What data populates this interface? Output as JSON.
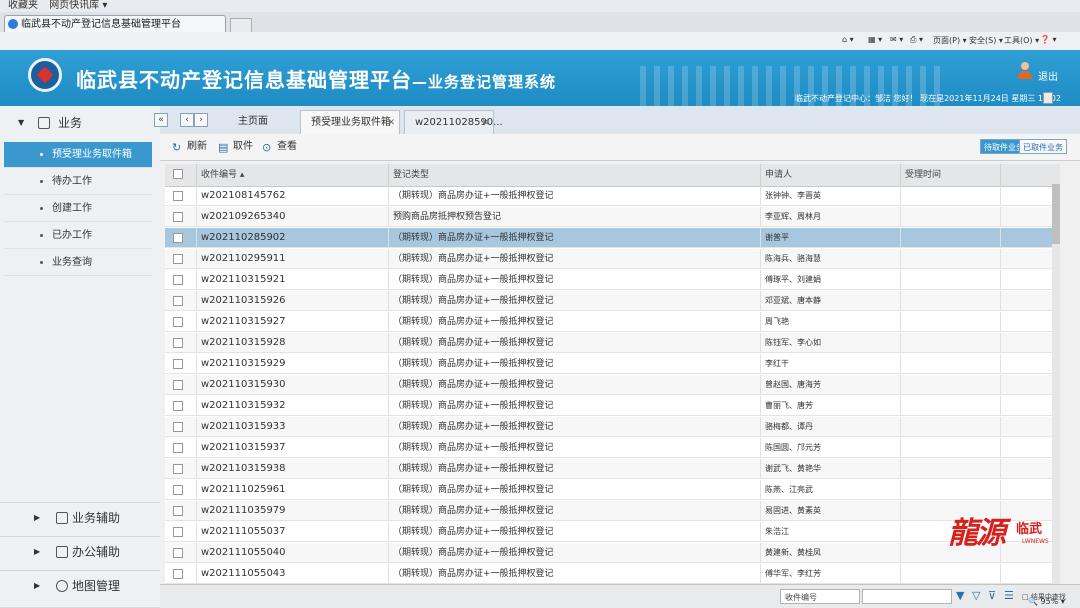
{
  "browser": {
    "favorites": [
      "收藏夹",
      "网页快讯库 ▾"
    ],
    "tab_title": "临武县不动产登记信息基础管理平台",
    "cmd_page": "页面(P) ▾",
    "cmd_safety": "安全(S) ▾",
    "cmd_tools": "工具(O) ▾",
    "cmd_help": "❓ ▾"
  },
  "header": {
    "title": "临武县不动产登记信息基础管理平台",
    "subtitle": "—业务登记管理系统",
    "logout": "退出",
    "user_info": "临武不动产登记中心：邹洁 您好！ 现在是2021年11月24日 星期三 10:02"
  },
  "sidebar": {
    "section_main": "业务",
    "items": [
      {
        "label": "预受理业务取件箱",
        "active": true
      },
      {
        "label": "待办工作",
        "active": false
      },
      {
        "label": "创建工作",
        "active": false
      },
      {
        "label": "已办工作",
        "active": false
      },
      {
        "label": "业务查询",
        "active": false
      }
    ],
    "bottom_sections": [
      "业务辅助",
      "办公辅助",
      "地图管理"
    ]
  },
  "content": {
    "tabs": {
      "home": "主页面",
      "inbox": "预受理业务取件箱",
      "record": "w20211028590..."
    },
    "toolbar": {
      "refresh": "刷新",
      "fetch": "取件",
      "view": "查看"
    },
    "filters": {
      "pending": "待取件业务",
      "done": "已取件业务"
    },
    "table": {
      "headers": [
        "收件编号 ▴",
        "登记类型",
        "申请人",
        "受理时间"
      ],
      "rows": [
        {
          "no": "w202108145762",
          "type": "（期转现）商品房办证+一般抵押权登记",
          "app": "张钟钟、李晋英",
          "sel": false
        },
        {
          "no": "w202109265340",
          "type": "预购商品房抵押权预告登记",
          "app": "李亚辉、周林月",
          "sel": false
        },
        {
          "no": "w202110285902",
          "type": "（期转现）商品房办证+一般抵押权登记",
          "app": "谢普平",
          "sel": true
        },
        {
          "no": "w202110295911",
          "type": "（期转现）商品房办证+一般抵押权登记",
          "app": "陈海兵、骆海慧",
          "sel": false
        },
        {
          "no": "w202110315921",
          "type": "（期转现）商品房办证+一般抵押权登记",
          "app": "傅琢平、刘建娟",
          "sel": false
        },
        {
          "no": "w202110315926",
          "type": "（期转现）商品房办证+一般抵押权登记",
          "app": "邓亚斌、唐本静",
          "sel": false
        },
        {
          "no": "w202110315927",
          "type": "（期转现）商品房办证+一般抵押权登记",
          "app": "周飞艳",
          "sel": false
        },
        {
          "no": "w202110315928",
          "type": "（期转现）商品房办证+一般抵押权登记",
          "app": "陈钰军、李心如",
          "sel": false
        },
        {
          "no": "w202110315929",
          "type": "（期转现）商品房办证+一般抵押权登记",
          "app": "李红干",
          "sel": false
        },
        {
          "no": "w202110315930",
          "type": "（期转现）商品房办证+一般抵押权登记",
          "app": "曾赵国、唐海芳",
          "sel": false
        },
        {
          "no": "w202110315932",
          "type": "（期转现）商品房办证+一般抵押权登记",
          "app": "曹丽飞、唐芳",
          "sel": false
        },
        {
          "no": "w202110315933",
          "type": "（期转现）商品房办证+一般抵押权登记",
          "app": "骆梅都、谭丹",
          "sel": false
        },
        {
          "no": "w202110315937",
          "type": "（期转现）商品房办证+一般抵押权登记",
          "app": "陈国圆、邝元芳",
          "sel": false
        },
        {
          "no": "w202110315938",
          "type": "（期转现）商品房办证+一般抵押权登记",
          "app": "谢武飞、黄艳华",
          "sel": false
        },
        {
          "no": "w202111025961",
          "type": "（期转现）商品房办证+一般抵押权登记",
          "app": "陈燕、江亮武",
          "sel": false
        },
        {
          "no": "w202111035979",
          "type": "（期转现）商品房办证+一般抵押权登记",
          "app": "易固进、黄素英",
          "sel": false
        },
        {
          "no": "w202111055037",
          "type": "（期转现）商品房办证+一般抵押权登记",
          "app": "朱浩江",
          "sel": false
        },
        {
          "no": "w202111055040",
          "type": "（期转现）商品房办证+一般抵押权登记",
          "app": "黄建新、黄桂凤",
          "sel": false
        },
        {
          "no": "w202111055043",
          "type": "（期转现）商品房办证+一般抵押权登记",
          "app": "傅华军、李红芳",
          "sel": false
        }
      ]
    },
    "bottom": {
      "field_label": "收件编号",
      "checkbox_label": "□ 结果中查找"
    }
  },
  "watermark": {
    "big": "龍源",
    "small": "临武",
    "tiny": "LWNEWS"
  },
  "status": {
    "zoom": "🔍 95% ▾"
  },
  "colors": {
    "header_bg": "#2e9fd4",
    "accent": "#3a98cf",
    "selected_row": "#a7c7df",
    "watermark": "#d6211d"
  }
}
